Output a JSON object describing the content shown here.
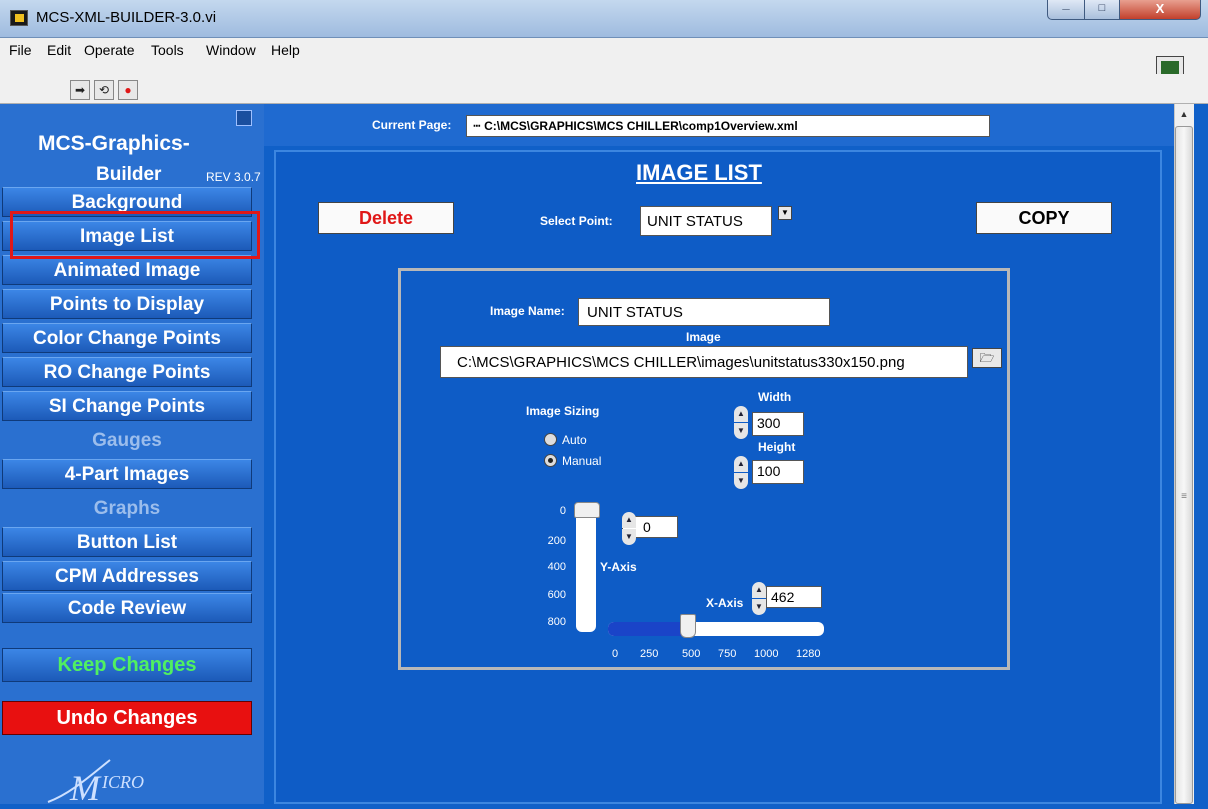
{
  "window": {
    "title": "MCS-XML-BUILDER-3.0.vi"
  },
  "menu": {
    "items": [
      "File",
      "Edit",
      "Operate",
      "Tools",
      "Window",
      "Help"
    ]
  },
  "sidebar": {
    "brand_line1": "MCS-Graphics-",
    "brand_line2": "Builder",
    "revision": "REV 3.0.7",
    "items": [
      {
        "label": "Background",
        "enabled": true
      },
      {
        "label": "Image List",
        "enabled": true,
        "selected": true
      },
      {
        "label": "Animated Image",
        "enabled": true
      },
      {
        "label": "Points to Display",
        "enabled": true
      },
      {
        "label": "Color Change Points",
        "enabled": true
      },
      {
        "label": "RO Change Points",
        "enabled": true
      },
      {
        "label": "SI Change Points",
        "enabled": true
      },
      {
        "label": "Gauges",
        "enabled": false
      },
      {
        "label": "4-Part Images",
        "enabled": true
      },
      {
        "label": "Graphs",
        "enabled": false
      },
      {
        "label": "Button List",
        "enabled": true
      },
      {
        "label": "CPM Addresses",
        "enabled": true
      },
      {
        "label": "Code Review",
        "enabled": true
      }
    ],
    "keep_changes": "Keep Changes",
    "undo_changes": "Undo Changes",
    "logo_text": "MICRO"
  },
  "main": {
    "current_page_label": "Current Page:",
    "current_page_value": "C:\\MCS\\GRAPHICS\\MCS CHILLER\\comp1Overview.xml",
    "section_title": "IMAGE LIST",
    "delete_label": "Delete",
    "copy_label": "COPY",
    "select_point_label": "Select Point:",
    "select_point_value": "UNIT STATUS",
    "image_name_label": "Image Name:",
    "image_name_value": "UNIT STATUS",
    "image_label": "Image",
    "image_path": "C:\\MCS\\GRAPHICS\\MCS CHILLER\\images\\unitstatus330x150.png",
    "image_sizing_label": "Image Sizing",
    "sizing_options": [
      "Auto",
      "Manual"
    ],
    "sizing_selected": "Manual",
    "width_label": "Width",
    "width_value": "300",
    "height_label": "Height",
    "height_value": "100",
    "y_axis_label": "Y-Axis",
    "y_value": "0",
    "y_ticks": [
      "0",
      "200",
      "400",
      "600",
      "800"
    ],
    "x_axis_label": "X-Axis",
    "x_value": "462",
    "x_ticks": [
      "0",
      "250",
      "500",
      "750",
      "1000",
      "1280"
    ]
  },
  "colors": {
    "panel_blue": "#0e5cc6",
    "delete_red": "#e01818",
    "keep_green": "#50f060",
    "undo_red": "#e81010",
    "selection_outline": "#e01818"
  }
}
